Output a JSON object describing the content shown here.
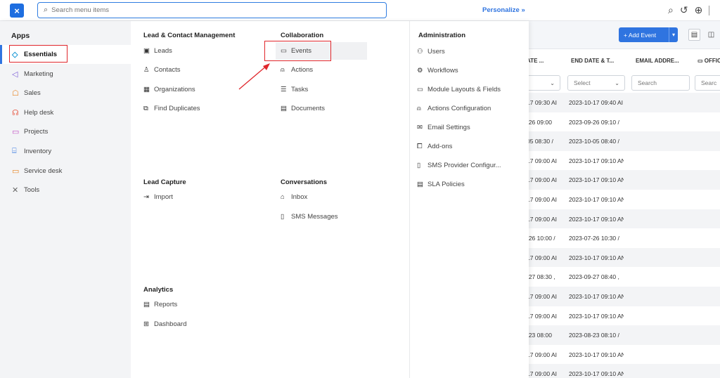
{
  "topbar": {
    "close_icon": "×",
    "search_placeholder": "Search menu items",
    "personalize": "Personalize »"
  },
  "apps": {
    "title": "Apps",
    "items": [
      {
        "label": "Essentials",
        "icon": "◇",
        "color": "#1f9bd7",
        "active": true
      },
      {
        "label": "Marketing",
        "icon": "◁",
        "color": "#7a5cd6"
      },
      {
        "label": "Sales",
        "icon": "☖",
        "color": "#e8821f"
      },
      {
        "label": "Help desk",
        "icon": "☊",
        "color": "#e8604c"
      },
      {
        "label": "Projects",
        "icon": "▭",
        "color": "#c24fc4"
      },
      {
        "label": "Inventory",
        "icon": "⌸",
        "color": "#2f74e0"
      },
      {
        "label": "Service desk",
        "icon": "▭",
        "color": "#e8821f"
      },
      {
        "label": "Tools",
        "icon": "✕",
        "color": "#666666"
      }
    ]
  },
  "sections": {
    "lead_contact": {
      "title": "Lead & Contact Management",
      "items": [
        "Leads",
        "Contacts",
        "Organizations",
        "Find Duplicates"
      ]
    },
    "collaboration": {
      "title": "Collaboration",
      "items": [
        "Events",
        "Actions",
        "Tasks",
        "Documents"
      ]
    },
    "lead_capture": {
      "title": "Lead Capture",
      "items": [
        "Import"
      ]
    },
    "conversations": {
      "title": "Conversations",
      "items": [
        "Inbox",
        "SMS Messages"
      ]
    },
    "analytics": {
      "title": "Analytics",
      "items": [
        "Reports",
        "Dashboard"
      ]
    },
    "administration": {
      "title": "Administration",
      "items": [
        "Users",
        "Workflows",
        "Module Layouts & Fields",
        "Actions Configuration",
        "Email Settings",
        "Add-ons",
        "SMS Provider Configur...",
        "SLA Policies"
      ]
    }
  },
  "background": {
    "add_event": "+ Add Event",
    "columns": [
      "ATE ...",
      "END DATE & T...",
      "EMAIL ADDRE...",
      "OFFIC"
    ],
    "filters": [
      "",
      "Select",
      "Search",
      "Searc"
    ],
    "rows": [
      [
        "17 09:30 AI",
        "2023-10-17 09:40 AI"
      ],
      [
        "-26 09:00",
        "2023-09-26 09:10 /"
      ],
      [
        "05 08:30 /",
        "2023-10-05 08:40 /"
      ],
      [
        "17 09:00 AI",
        "2023-10-17 09:10 AN"
      ],
      [
        "17 09:00 AI",
        "2023-10-17 09:10 AN"
      ],
      [
        "17 09:00 AI",
        "2023-10-17 09:10 AN"
      ],
      [
        "17 09:00 AI",
        "2023-10-17 09:10 AN"
      ],
      [
        "-26 10:00 /",
        "2023-07-26 10:30 /"
      ],
      [
        "17 09:00 AI",
        "2023-10-17 09:10 AN"
      ],
      [
        "-27 08:30 ,",
        "2023-09-27 08:40 ,"
      ],
      [
        "17 09:00 AI",
        "2023-10-17 09:10 AN"
      ],
      [
        "17 09:00 AI",
        "2023-10-17 09:10 AN"
      ],
      [
        "-23 08:00",
        "2023-08-23 08:10 /"
      ],
      [
        "17 09:00 AI",
        "2023-10-17 09:10 AN"
      ],
      [
        "17 09:00 AI",
        "2023-10-17 09:10 AN"
      ]
    ]
  }
}
